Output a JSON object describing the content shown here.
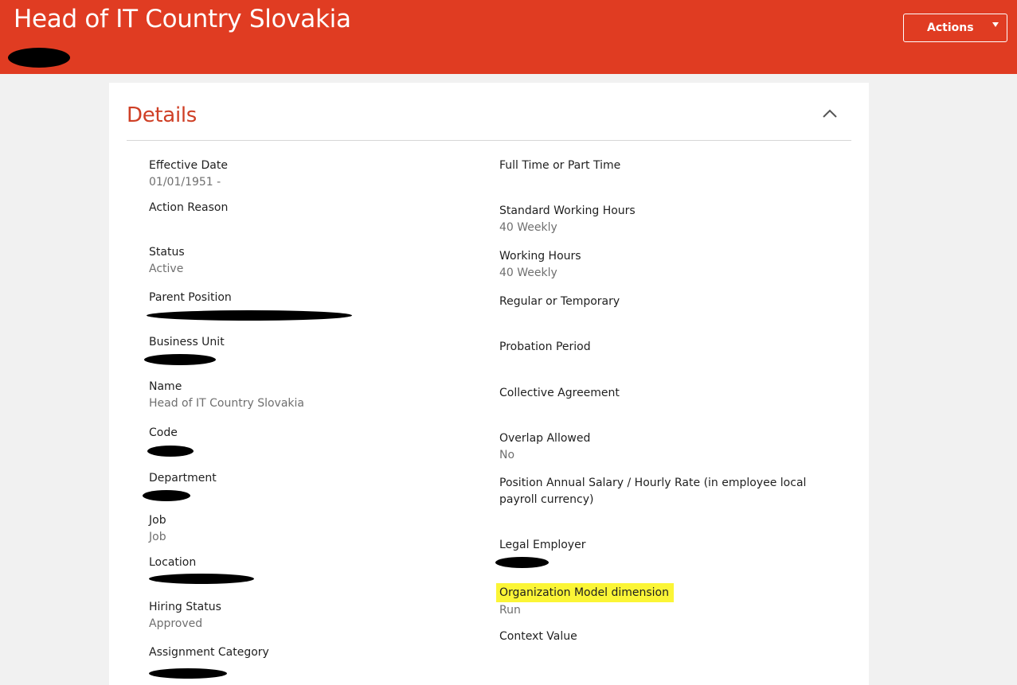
{
  "header": {
    "title": "Head of IT Country Slovakia",
    "actions_label": "Actions",
    "colors": {
      "brand": "#e03c22",
      "text": "#ffffff"
    }
  },
  "details": {
    "title": "Details",
    "collapse_icon": "chevron-up-icon",
    "left": [
      {
        "label": "Effective Date",
        "value": "01/01/1951 -"
      },
      {
        "label": "Action Reason",
        "value": ""
      },
      {
        "label": "Status",
        "value": "Active"
      },
      {
        "label": "Parent Position",
        "value": ""
      },
      {
        "label": "Business Unit",
        "value": ""
      },
      {
        "label": "Name",
        "value": "Head of IT Country Slovakia"
      },
      {
        "label": "Code",
        "value": ""
      },
      {
        "label": "Department",
        "value": ""
      },
      {
        "label": "Job",
        "value": "Job"
      },
      {
        "label": "Location",
        "value": ""
      },
      {
        "label": "Hiring Status",
        "value": "Approved"
      },
      {
        "label": "Assignment Category",
        "value": ""
      }
    ],
    "right": [
      {
        "label": "Full Time or Part Time",
        "value": ""
      },
      {
        "label": "Standard Working Hours",
        "value": "40 Weekly"
      },
      {
        "label": "Working Hours",
        "value": "40 Weekly"
      },
      {
        "label": "Regular or Temporary",
        "value": ""
      },
      {
        "label": "Probation Period",
        "value": ""
      },
      {
        "label": "Collective Agreement",
        "value": ""
      },
      {
        "label": "Overlap Allowed",
        "value": "No"
      },
      {
        "label": "Position Annual Salary / Hourly Rate (in employee local payroll currency)",
        "value": ""
      },
      {
        "label": "Legal Employer",
        "value": ""
      },
      {
        "label": "Organization Model dimension",
        "value": "Run"
      },
      {
        "label": "Context Value",
        "value": ""
      }
    ],
    "colors": {
      "title": "#cf3f25",
      "highlight": "#fbf536",
      "value": "#6f6f6f"
    }
  }
}
